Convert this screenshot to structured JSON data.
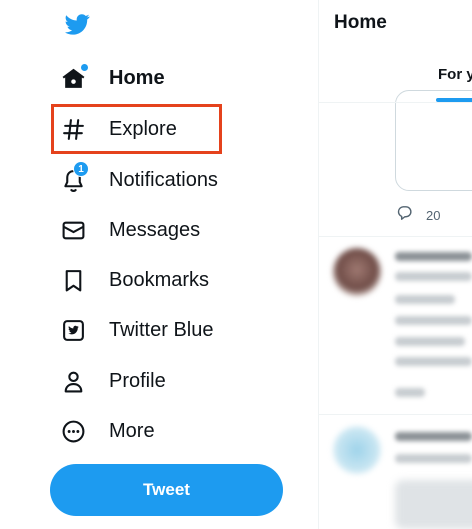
{
  "nav": {
    "items": [
      {
        "label": "Home",
        "icon": "home-icon",
        "active": true,
        "unread_dot": true
      },
      {
        "label": "Explore",
        "icon": "hashtag-icon",
        "highlighted": true
      },
      {
        "label": "Notifications",
        "icon": "bell-icon",
        "badge": "1"
      },
      {
        "label": "Messages",
        "icon": "envelope-icon"
      },
      {
        "label": "Bookmarks",
        "icon": "bookmark-icon"
      },
      {
        "label": "Twitter Blue",
        "icon": "twitter-blue-icon"
      },
      {
        "label": "Profile",
        "icon": "person-icon"
      },
      {
        "label": "More",
        "icon": "more-circle-icon"
      }
    ],
    "tweet_button": "Tweet"
  },
  "main": {
    "title": "Home",
    "tab_for_you": "For y",
    "reply_count": "20"
  },
  "colors": {
    "brand": "#1d9bf0",
    "highlight_box": "#e5421c",
    "text": "#0f1419"
  }
}
